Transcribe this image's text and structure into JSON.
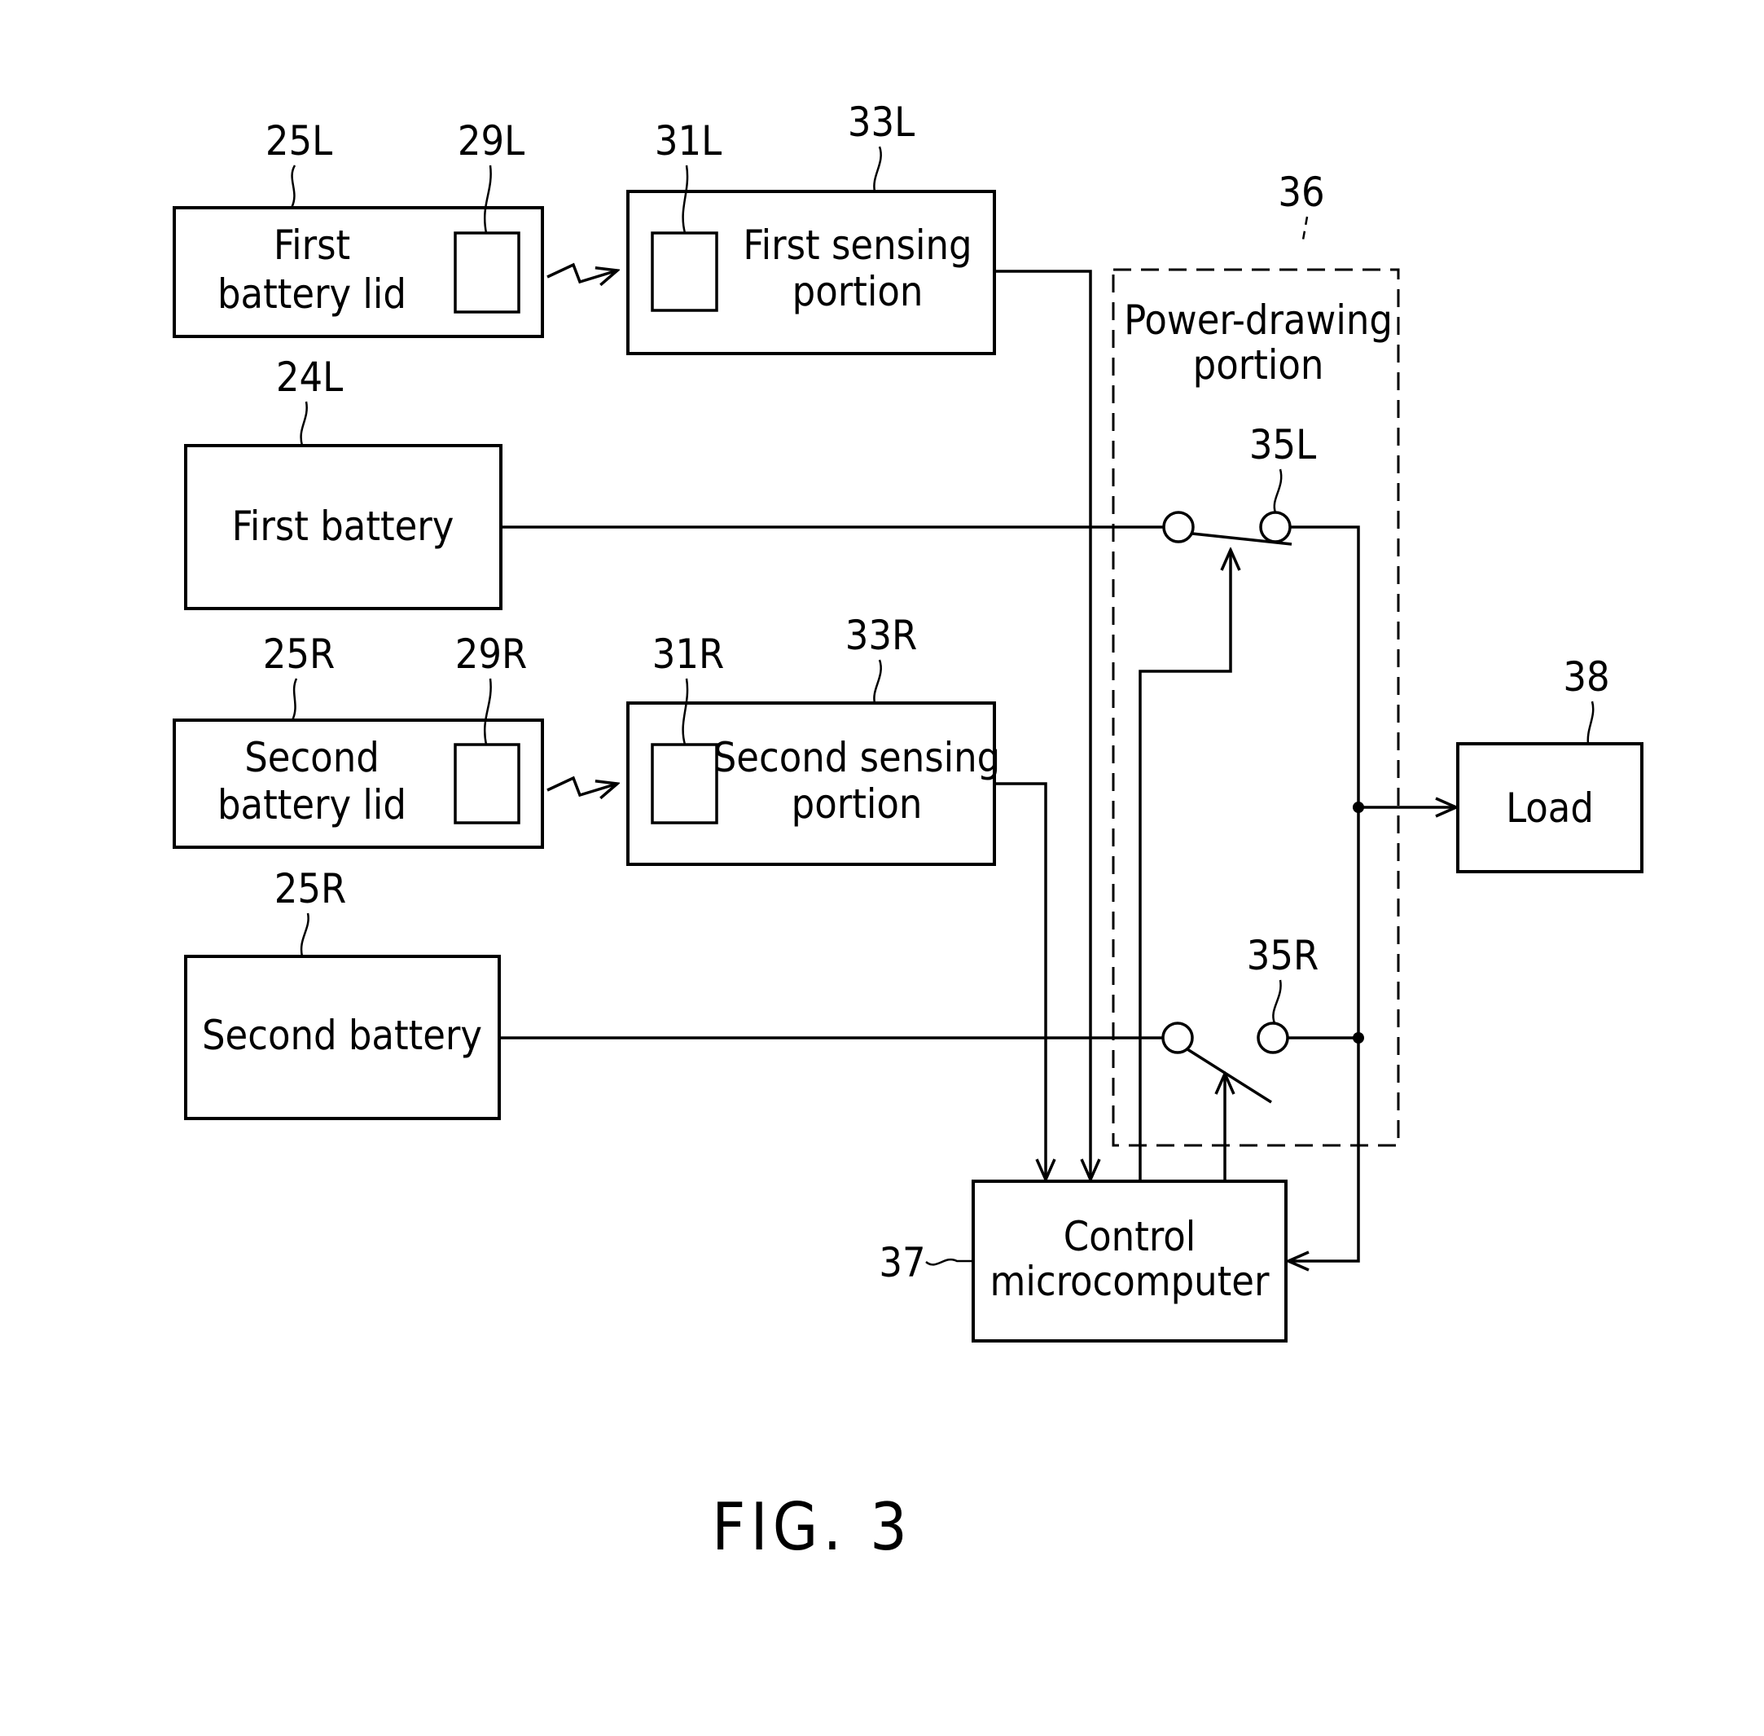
{
  "figure": {
    "caption": "FIG. 3"
  },
  "blocks": {
    "first_lid": {
      "ref": "25L",
      "line1": "First",
      "line2": "battery lid",
      "inner_ref": "29L"
    },
    "first_sensing": {
      "ref": "33L",
      "line1": "First sensing",
      "line2": "portion",
      "inner_ref": "31L"
    },
    "first_battery": {
      "ref": "24L",
      "label": "First battery"
    },
    "second_lid": {
      "ref": "25R",
      "line1": "Second",
      "line2": "battery lid",
      "inner_ref": "29R"
    },
    "second_sensing": {
      "ref": "33R",
      "line1": "Second sensing",
      "line2": "portion",
      "inner_ref": "31R"
    },
    "second_battery": {
      "ref": "25R",
      "label": "Second battery"
    },
    "power_drawing": {
      "ref": "36",
      "line1": "Power-drawing",
      "line2": "portion"
    },
    "switch_left": {
      "ref": "35L"
    },
    "switch_right": {
      "ref": "35R"
    },
    "load": {
      "ref": "38",
      "label": "Load"
    },
    "control": {
      "ref": "37",
      "line1": "Control",
      "line2": "microcomputer"
    }
  }
}
